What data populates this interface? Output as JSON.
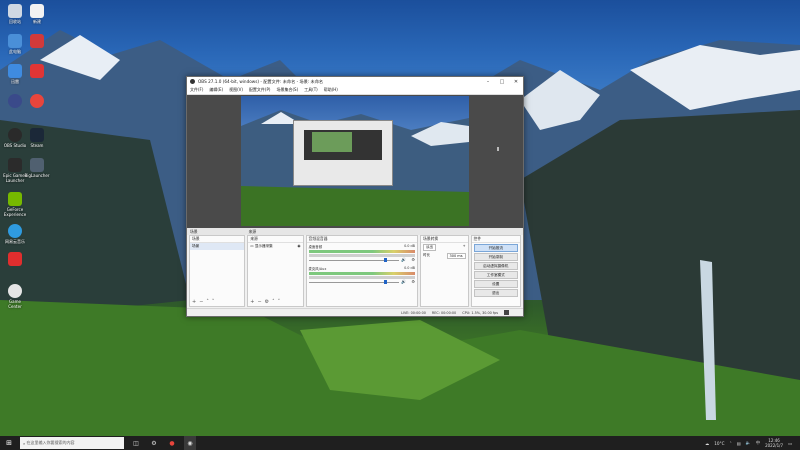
{
  "colors": {
    "accent": "#1f63c6",
    "taskbar": "#1f1f1f",
    "window_bg": "#f0f0f0",
    "preview_bg": "#4a4a4a"
  },
  "desktop_icons": [
    {
      "label": "回收站",
      "icon": "recycle-bin-icon"
    },
    {
      "label": "新建",
      "icon": "document-icon"
    },
    {
      "label": "此电脑",
      "icon": "computer-icon"
    },
    {
      "label": "",
      "icon": "app-icon"
    },
    {
      "label": "迅雷",
      "icon": "thunder-icon"
    },
    {
      "label": "",
      "icon": "app-icon"
    },
    {
      "label": "OBS Studio",
      "icon": "obs-icon"
    },
    {
      "label": "Steam",
      "icon": "steam-icon"
    },
    {
      "label": "Epic Games Launcher",
      "icon": "epic-icon"
    },
    {
      "label": "BigLauncher",
      "icon": "launcher-icon"
    },
    {
      "label": "GeForce Experience",
      "icon": "geforce-icon"
    },
    {
      "label": "",
      "icon": "app-icon"
    },
    {
      "label": "网易云音乐",
      "icon": "music-icon"
    },
    {
      "label": "",
      "icon": "app-icon"
    },
    {
      "label": "Game Center",
      "icon": "game-icon"
    }
  ],
  "obs": {
    "title": "OBS 27.1.0 (64-bit, windows) - 配置文件: 未命名 - 场景: 未命名",
    "menu": [
      "文件(F)",
      "编辑(E)",
      "视图(V)",
      "配置文件(P)",
      "场景集合(S)",
      "工具(T)",
      "帮助(H)"
    ],
    "tabs": [
      "场景",
      "来源"
    ],
    "docks": {
      "scenes": {
        "header": "场景",
        "items": [
          "场景"
        ]
      },
      "sources": {
        "header": "来源",
        "items": [
          "显示器采集"
        ]
      },
      "mixer": {
        "header": "音频混音器",
        "channels": [
          {
            "name": "桌面音频",
            "db": "0.0 dB",
            "level": 0.83
          },
          {
            "name": "麦克风/Aux",
            "db": "0.0 dB",
            "level": 0.83
          }
        ]
      },
      "transitions": {
        "header": "场景转换",
        "type": "淡出",
        "duration_label": "时长",
        "duration": "300 ms"
      },
      "controls": {
        "header": "控件",
        "buttons": [
          "开始推流",
          "开始录制",
          "启动虚拟摄像机",
          "工作室模式",
          "设置",
          "退出"
        ]
      }
    },
    "statusbar": {
      "live": "LIVE: 00:00:00",
      "rec": "REC: 00:00:00",
      "cpu": "CPU: 1.5%, 30.00 fps"
    }
  },
  "taskbar": {
    "search_placeholder": "在这里输入你要搜索的内容",
    "weather": "10°C",
    "time": "12:46",
    "date": "2022/1/7"
  }
}
